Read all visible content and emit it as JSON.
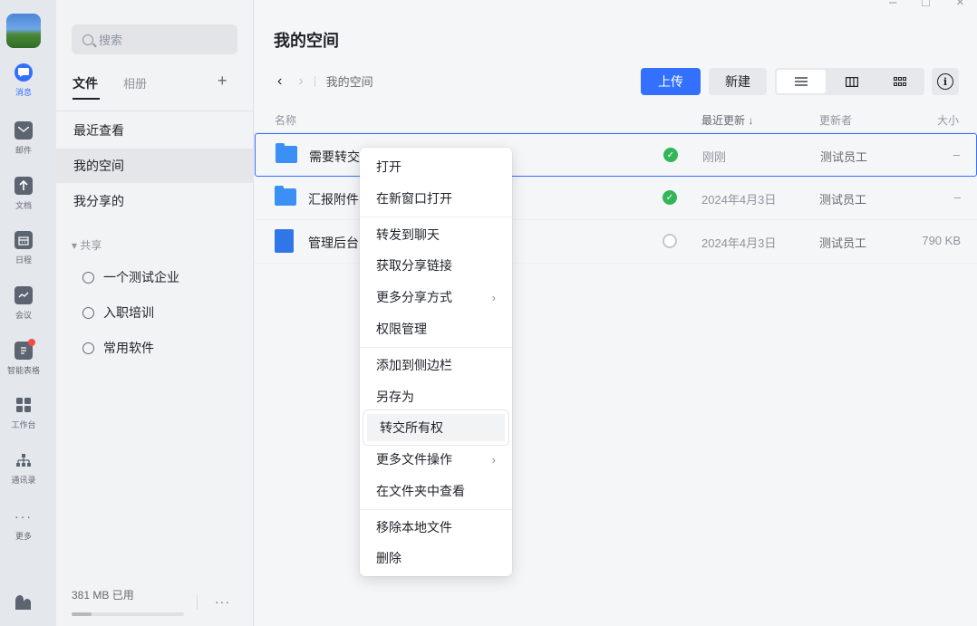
{
  "rail": {
    "items": [
      {
        "label": "消息",
        "icon": "chat-icon"
      },
      {
        "label": "邮件",
        "icon": "mail-icon"
      },
      {
        "label": "文档",
        "icon": "docs-icon"
      },
      {
        "label": "日程",
        "icon": "calendar-icon"
      },
      {
        "label": "会议",
        "icon": "meeting-icon"
      },
      {
        "label": "智能表格",
        "icon": "smart-table-icon"
      },
      {
        "label": "工作台",
        "icon": "workbench-icon"
      },
      {
        "label": "通讯录",
        "icon": "contacts-icon"
      },
      {
        "label": "更多",
        "icon": "more-icon"
      }
    ]
  },
  "sidebar": {
    "search_placeholder": "搜索",
    "tab_files": "文件",
    "tab_album": "相册",
    "add_label": "+",
    "nav": [
      "最近查看",
      "我的空间",
      "我分享的"
    ],
    "share_header": "▾ 共享",
    "shares": [
      "一个测试企业",
      "入职培训",
      "常用软件"
    ],
    "storage_text": "381 MB 已用",
    "storage_fraction": 0.18,
    "more_label": "···"
  },
  "main": {
    "title": "我的空间",
    "breadcrumb": "我的空间",
    "upload_label": "上传",
    "new_label": "新建",
    "columns": {
      "name": "名称",
      "updated": "最近更新 ↓",
      "updater": "更新者",
      "size": "大小"
    },
    "rows": [
      {
        "name": "需要转交",
        "status": "ok",
        "date": "刚刚",
        "updater": "测试员工",
        "size": "–",
        "type": "folder"
      },
      {
        "name": "汇报附件",
        "status": "ok",
        "date": "2024年4月3日",
        "updater": "测试员工",
        "size": "–",
        "type": "folder"
      },
      {
        "name": "管理后台",
        "status": "pending",
        "date": "2024年4月3日",
        "updater": "测试员工",
        "size": "790 KB",
        "type": "doc"
      }
    ]
  },
  "menu": {
    "items": [
      "打开",
      "在新窗口打开",
      "转发到聊天",
      "获取分享链接",
      "更多分享方式",
      "权限管理",
      "添加到侧边栏",
      "另存为",
      "转交所有权",
      "更多文件操作",
      "在文件夹中查看",
      "移除本地文件",
      "删除"
    ],
    "highlighted": "转交所有权"
  },
  "colors": {
    "accent": "#3370ff",
    "success": "#34b559"
  }
}
